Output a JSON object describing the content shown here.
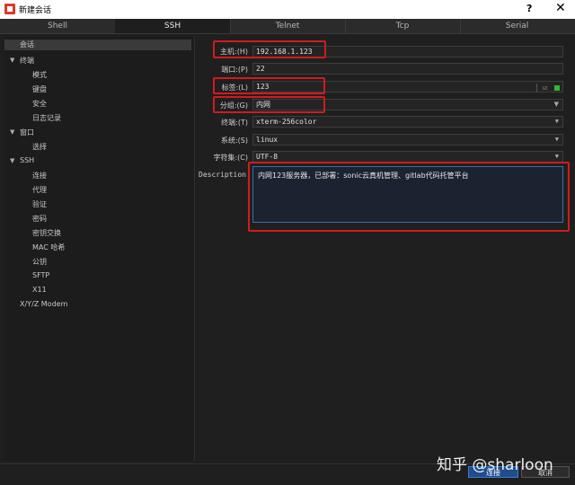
{
  "window": {
    "title": "新建会话",
    "help": "?",
    "close": "✕"
  },
  "tabs": [
    "Shell",
    "SSH",
    "Telnet",
    "Tcp",
    "Serial"
  ],
  "sidebar": {
    "items": [
      {
        "label": "会话",
        "level": 0
      },
      {
        "label": "终端",
        "level": 0,
        "expanded": true
      },
      {
        "label": "模式",
        "level": 1
      },
      {
        "label": "键盘",
        "level": 1
      },
      {
        "label": "安全",
        "level": 1
      },
      {
        "label": "日志记录",
        "level": 1
      },
      {
        "label": "窗口",
        "level": 0,
        "expanded": true
      },
      {
        "label": "选择",
        "level": 1
      },
      {
        "label": "SSH",
        "level": 0,
        "expanded": true
      },
      {
        "label": "连接",
        "level": 1
      },
      {
        "label": "代理",
        "level": 1
      },
      {
        "label": "验证",
        "level": 1
      },
      {
        "label": "密码",
        "level": 1
      },
      {
        "label": "密钥交换",
        "level": 1
      },
      {
        "label": "MAC 哈希",
        "level": 1
      },
      {
        "label": "公钥",
        "level": 1
      },
      {
        "label": "SFTP",
        "level": 1
      },
      {
        "label": "X11",
        "level": 1
      },
      {
        "label": "X/Y/Z Modem",
        "level": 0
      }
    ]
  },
  "form": {
    "host_label": "主机:(H)",
    "host_value": "192.168.1.123",
    "port_label": "端口:(P)",
    "port_value": "22",
    "tag_label": "标签:(L)",
    "tag_value": "123",
    "group_label": "分组:(G)",
    "group_value": "内网",
    "term_label": "终端:(T)",
    "term_value": "xterm-256color",
    "system_label": "系统:(S)",
    "system_value": "linux",
    "charset_label": "字符集:(C)",
    "charset_value": "UTF-8",
    "desc_label": "Description",
    "desc_value": "内网123服务器，已部署：sonic云真机管理、gitlab代码托管平台"
  },
  "buttons": {
    "connect": "连接",
    "cancel": "取消"
  },
  "watermark": "知乎 @sharloon",
  "colors": {
    "highlight": "#d01c1c",
    "primary": "#1e4e8c",
    "status_green": "#2eb82e"
  }
}
